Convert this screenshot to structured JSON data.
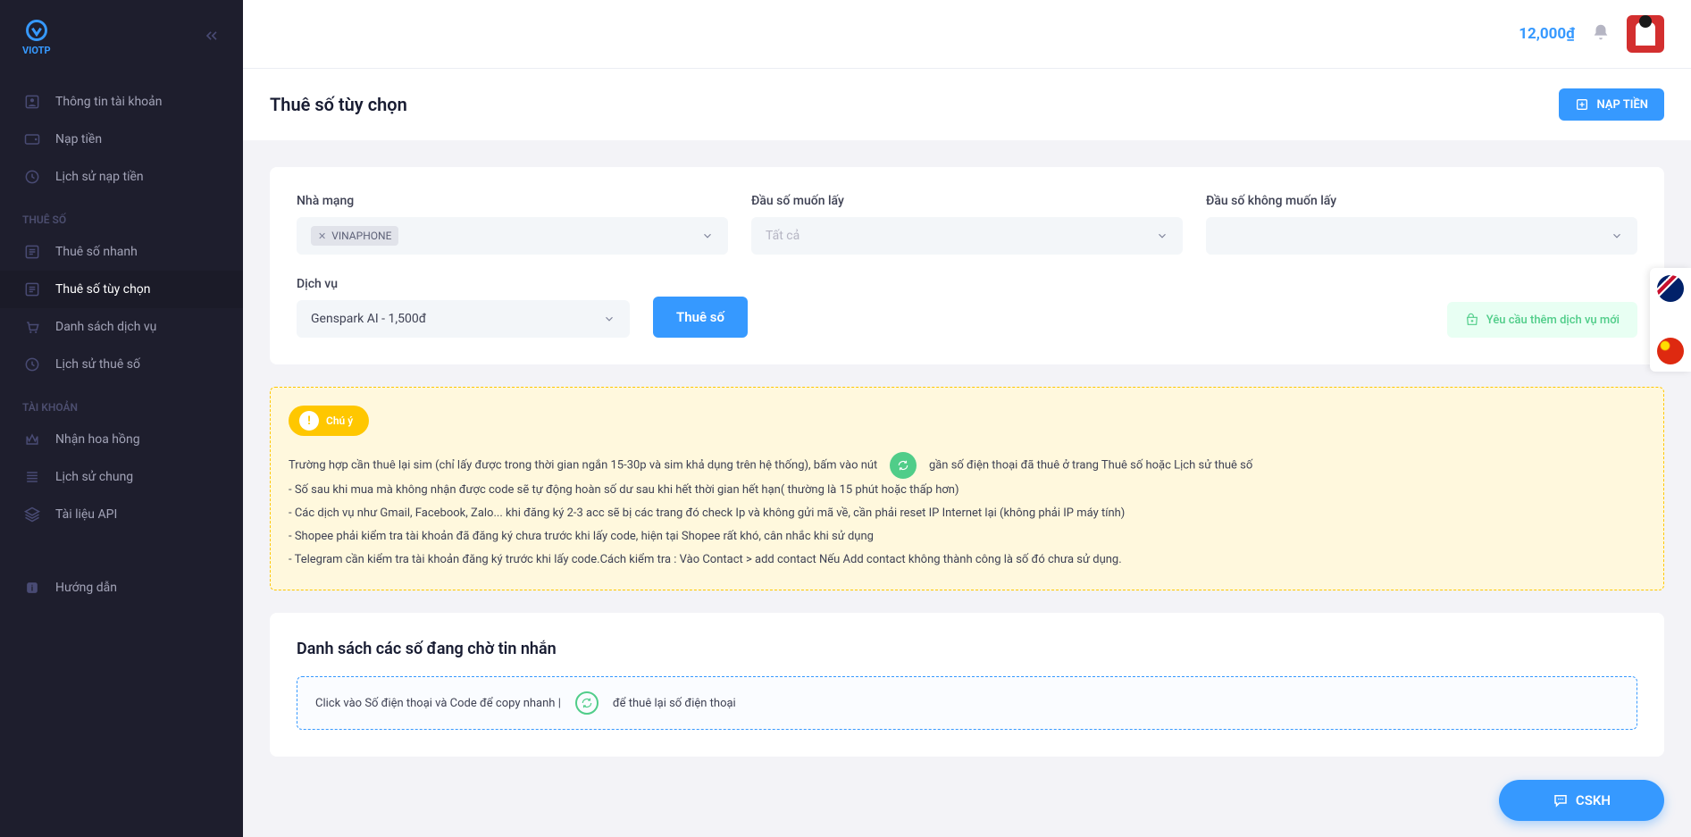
{
  "brand": "VIOTP",
  "topbar": {
    "balance": "12,000₫"
  },
  "sidebar": {
    "items_main": [
      {
        "label": "Thông tin tài khoản",
        "icon": "user"
      },
      {
        "label": "Nạp tiền",
        "icon": "wallet"
      },
      {
        "label": "Lịch sử nạp tiền",
        "icon": "clock"
      }
    ],
    "section_thue": "THUÊ SỐ",
    "items_thue": [
      {
        "label": "Thuê số nhanh",
        "icon": "list"
      },
      {
        "label": "Thuê số tùy chọn",
        "icon": "list",
        "active": true
      },
      {
        "label": "Danh sách dịch vụ",
        "icon": "cart"
      },
      {
        "label": "Lịch sử thuê số",
        "icon": "clock"
      }
    ],
    "section_taikhoan": "TÀI KHOẢN",
    "items_taikhoan": [
      {
        "label": "Nhận hoa hồng",
        "icon": "crown"
      },
      {
        "label": "Lịch sử chung",
        "icon": "list"
      },
      {
        "label": "Tài liệu API",
        "icon": "layers"
      }
    ],
    "items_bottom": [
      {
        "label": "Hướng dẫn",
        "icon": "info"
      }
    ]
  },
  "page": {
    "title": "Thuê số tùy chọn",
    "nap_tien_btn": "NẠP TIỀN"
  },
  "form": {
    "nha_mang_label": "Nhà mạng",
    "nha_mang_tag": "VINAPHONE",
    "dau_so_lay_label": "Đầu số muốn lấy",
    "dau_so_lay_placeholder": "Tất cả",
    "dau_so_khong_label": "Đầu số không muốn lấy",
    "dich_vu_label": "Dịch vụ",
    "dich_vu_value": "Genspark AI - 1,500đ",
    "thue_so_btn": "Thuê số",
    "yeu_cau_btn": "Yêu cầu thêm dịch vụ mới"
  },
  "notice": {
    "badge": "Chú ý",
    "line1a": "Trường hợp cần thuê lại sim (chỉ lấy được trong thời gian ngắn 15-30p và sim khả dụng trên hệ thống), bấm vào nút",
    "line1b": "gần số điện thoại đã thuê ở trang Thuê số hoặc Lịch sử thuê số",
    "line2": "- Số sau khi mua mà không nhận được code sẽ tự động hoàn số dư sau khi hết thời gian hết hạn( thường là 15 phút hoặc thấp hơn)",
    "line3": "- Các dịch vụ như Gmail, Facebook, Zalo... khi đăng ký 2-3 acc sẽ bị các trang đó check Ip và không gửi mã về, cần phải reset IP Internet lại (không phải IP máy tính)",
    "line4": "- Shopee phải kiểm tra tài khoản đã đăng ký chưa trước khi lấy code, hiện tại Shopee rất khó, cân nhắc khi sử dụng",
    "line5": "- Telegram cần kiểm tra tài khoản đăng ký trước khi lấy code.Cách kiểm tra : Vào Contact > add contact Nếu Add contact không thành công là số đó chưa sử dụng."
  },
  "waiting": {
    "title": "Danh sách các số đang chờ tin nhắn",
    "tip_a": "Click vào Số điện thoại và Code để copy nhanh |",
    "tip_b": "để thuê lại số điện thoại"
  },
  "cskh": "CSKH"
}
